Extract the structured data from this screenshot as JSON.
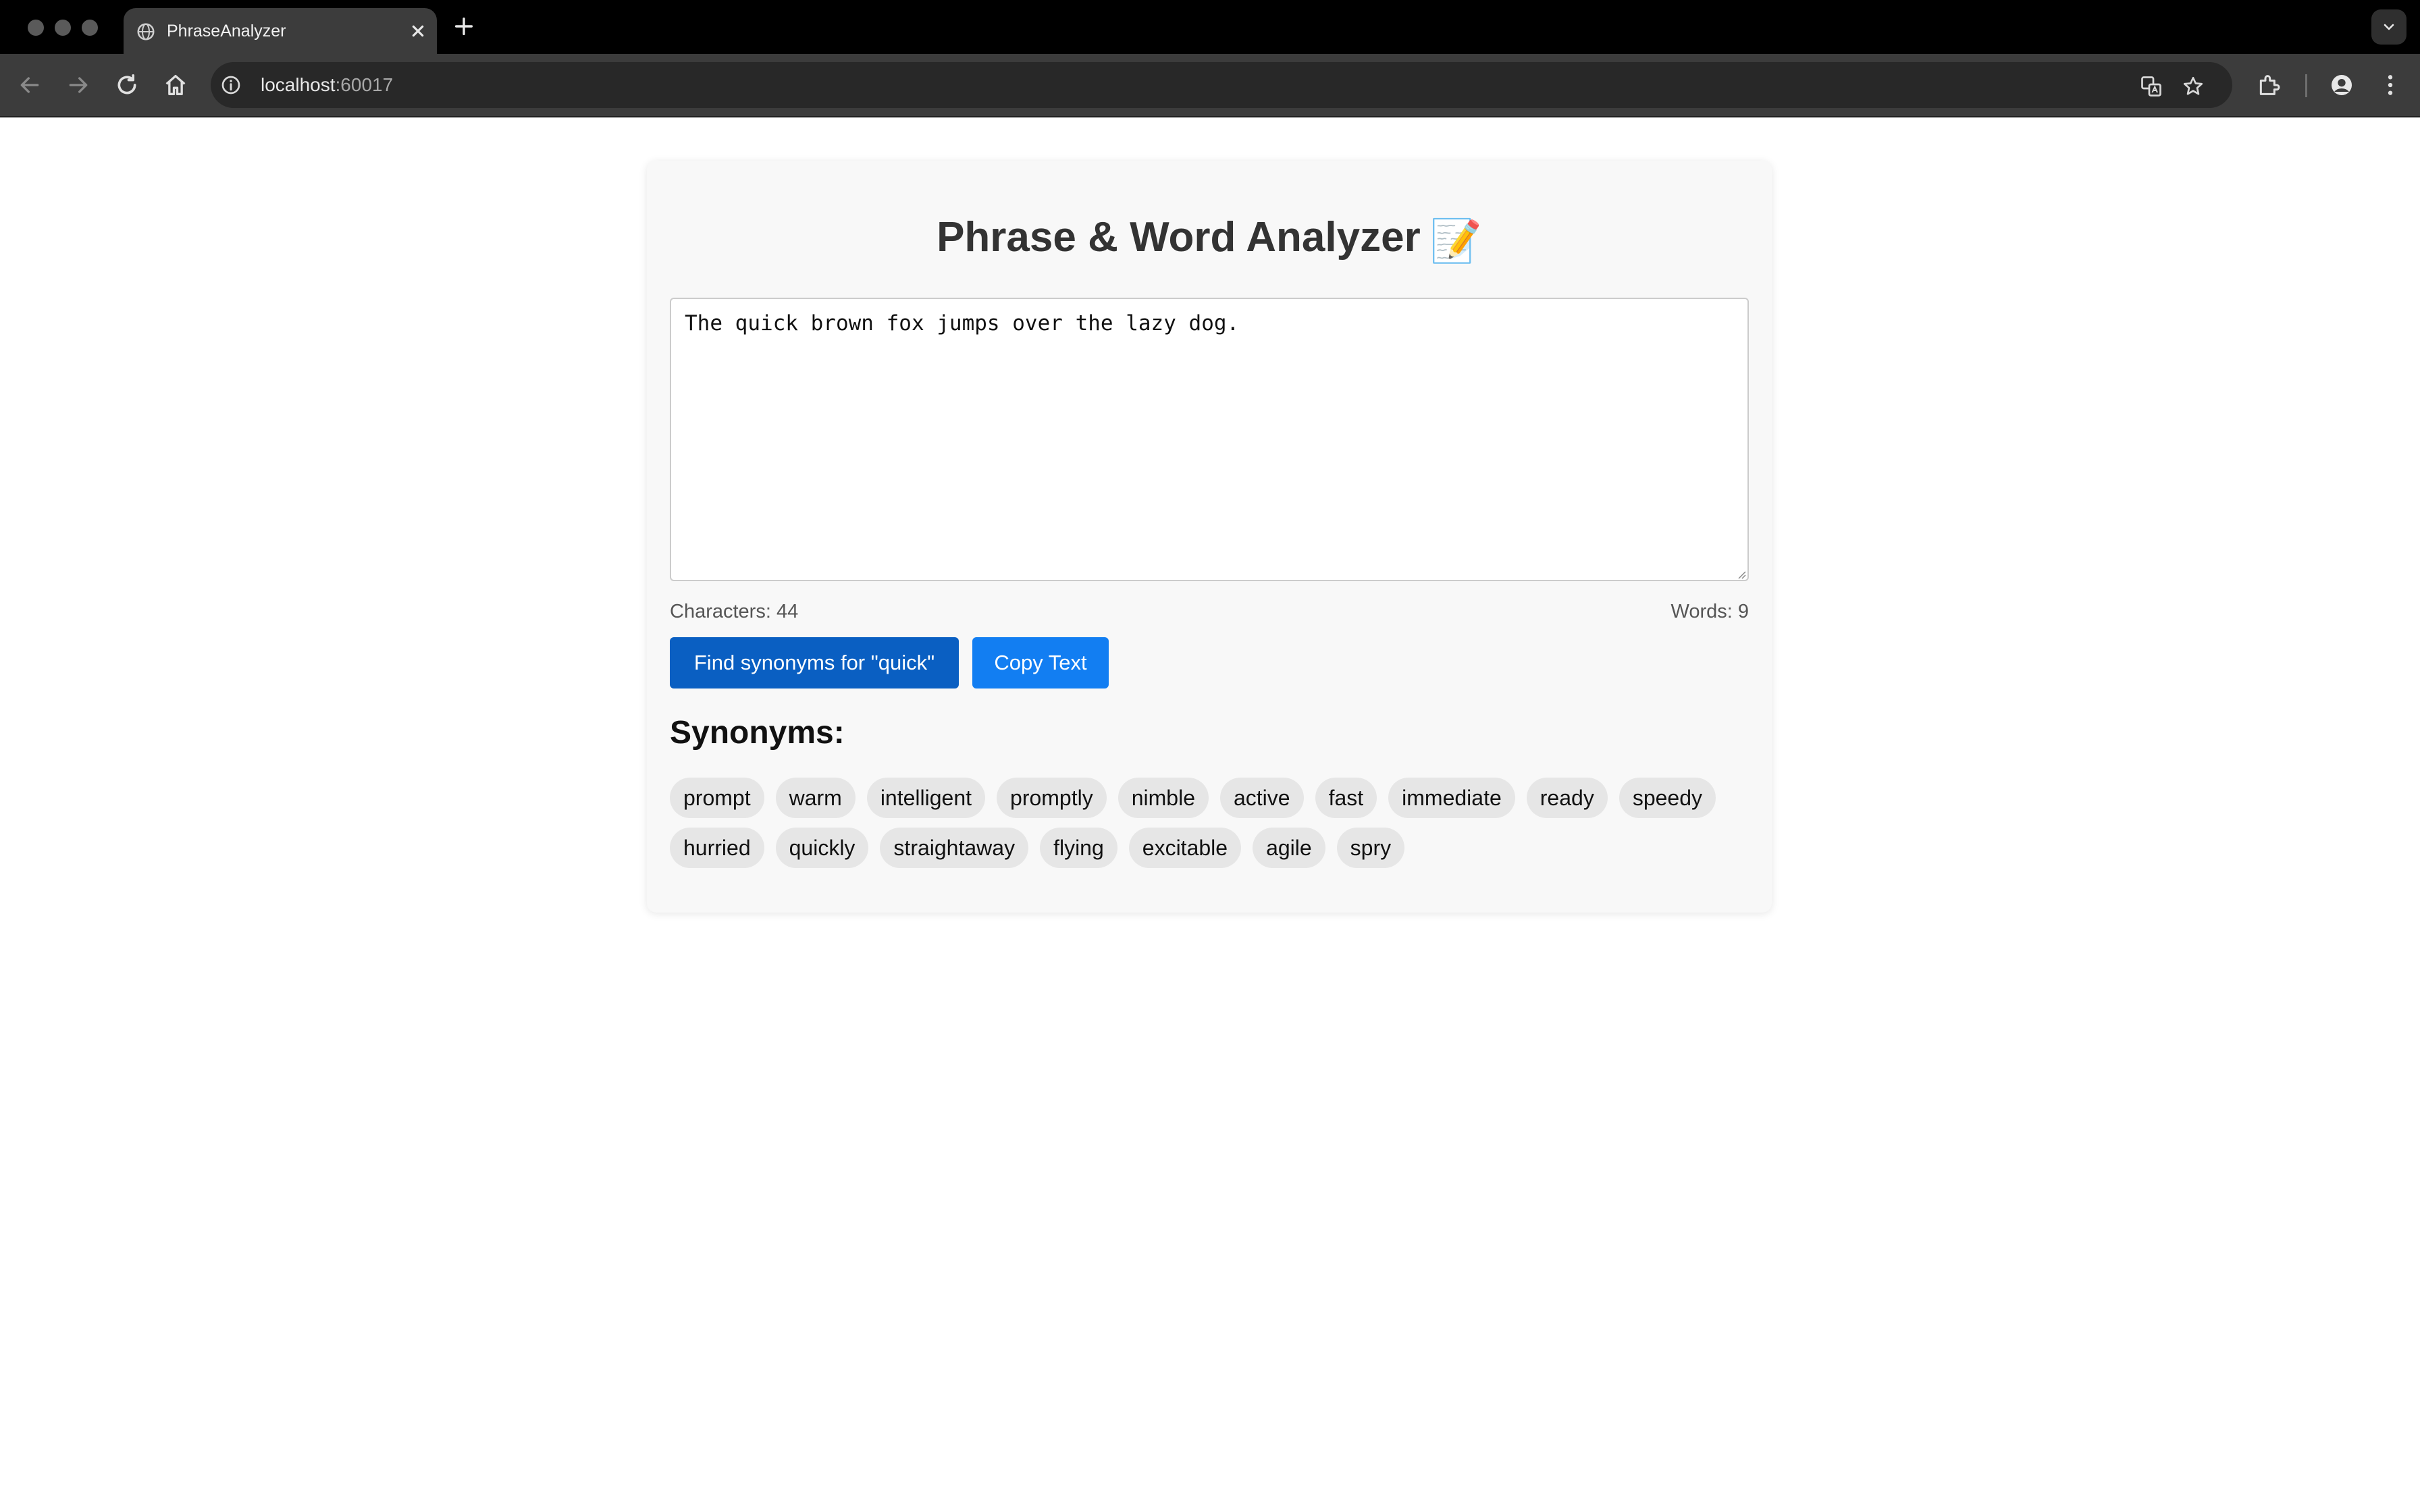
{
  "browser": {
    "tab_title": "PhraseAnalyzer",
    "url_host": "localhost",
    "url_port": ":60017"
  },
  "app": {
    "title": "Phrase & Word Analyzer",
    "title_emoji": "📝",
    "input_text": "The quick brown fox jumps over the lazy dog.",
    "stats": {
      "characters_label": "Characters: 44",
      "words_label": "Words: 9"
    },
    "buttons": {
      "find_synonyms": "Find synonyms for \"quick\"",
      "copy_text": "Copy Text"
    },
    "synonyms_heading": "Synonyms:",
    "synonyms": [
      "prompt",
      "warm",
      "intelligent",
      "promptly",
      "nimble",
      "active",
      "fast",
      "immediate",
      "ready",
      "speedy",
      "hurried",
      "quickly",
      "straightaway",
      "flying",
      "excitable",
      "agile",
      "spry"
    ]
  },
  "colors": {
    "primary_button": "#0a5fc2",
    "secondary_button": "#127ef2",
    "chip_background": "#e6e6e6"
  }
}
